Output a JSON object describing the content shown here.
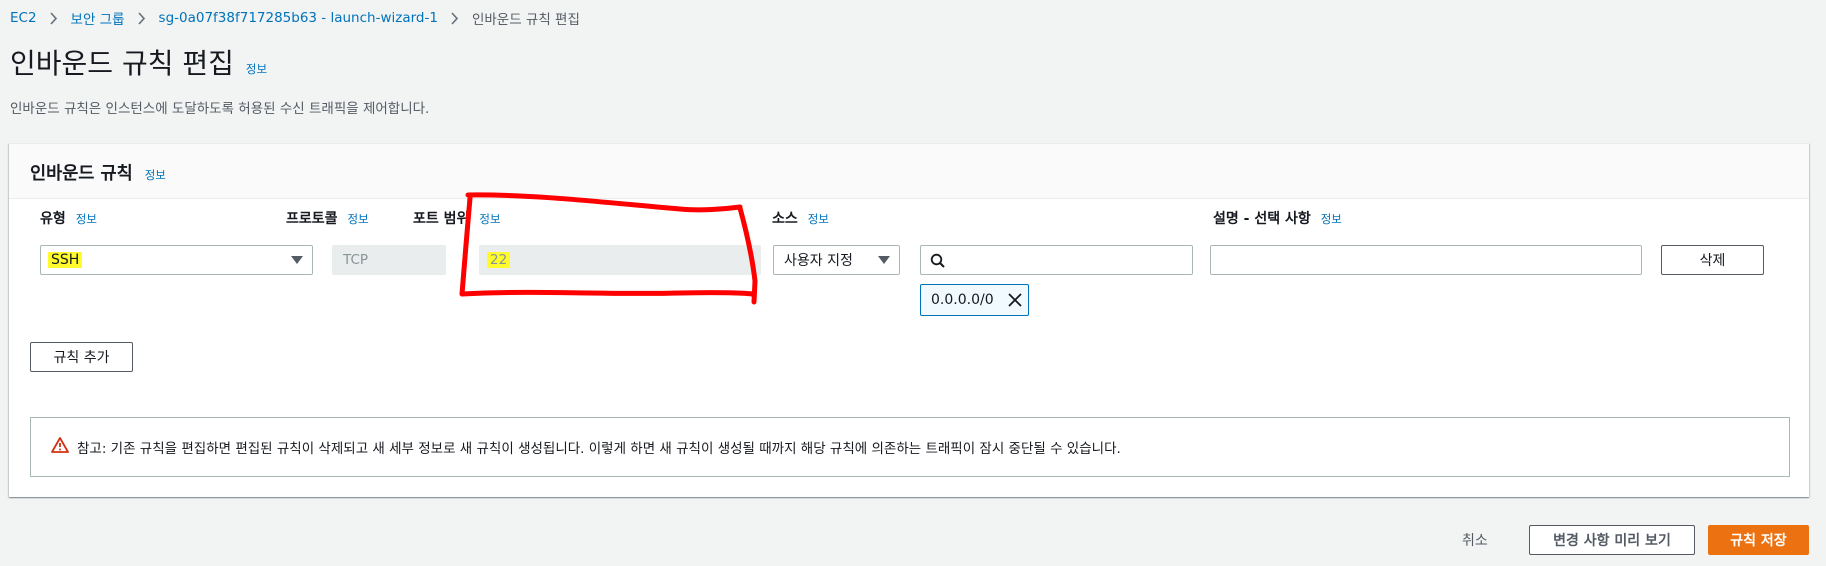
{
  "breadcrumb": {
    "items": [
      "EC2",
      "보안 그룹",
      "sg-0a07f38f717285b63 - launch-wizard-1",
      "인바운드 규칙 편집"
    ]
  },
  "page": {
    "title": "인바운드 규칙 편집",
    "info": "정보",
    "description": "인바운드 규칙은 인스턴스에 도달하도록 허용된 수신 트래픽을 제어합니다."
  },
  "panel": {
    "title": "인바운드 규칙",
    "info": "정보",
    "columns": {
      "type": "유형",
      "protocol": "프로토콜",
      "port_range": "포트 범위",
      "source": "소스",
      "description": "설명 - 선택 사항"
    },
    "info_label": "정보",
    "rule": {
      "type": "SSH",
      "protocol": "TCP",
      "port_range": "22",
      "source_type": "사용자 지정",
      "source_search_value": "",
      "source_token": "0.0.0.0/0",
      "description_value": "",
      "delete_label": "삭제"
    },
    "add_rule_label": "규칙 추가",
    "alert_text": "참고: 기존 규칙을 편집하면 편집된 규칙이 삭제되고 새 세부 정보로 새 규칙이 생성됩니다. 이렇게 하면 새 규칙이 생성될 때까지 해당 규칙에 의존하는 트래픽이 잠시 중단될 수 있습니다."
  },
  "footer": {
    "cancel_label": "취소",
    "preview_label": "변경 사항 미리 보기",
    "save_label": "규칙 저장"
  },
  "colors": {
    "link": "#0073bb",
    "primary": "#ec7211",
    "highlight": "#fffb2c",
    "annotation": "#ff0000",
    "warning": "#d13212"
  }
}
